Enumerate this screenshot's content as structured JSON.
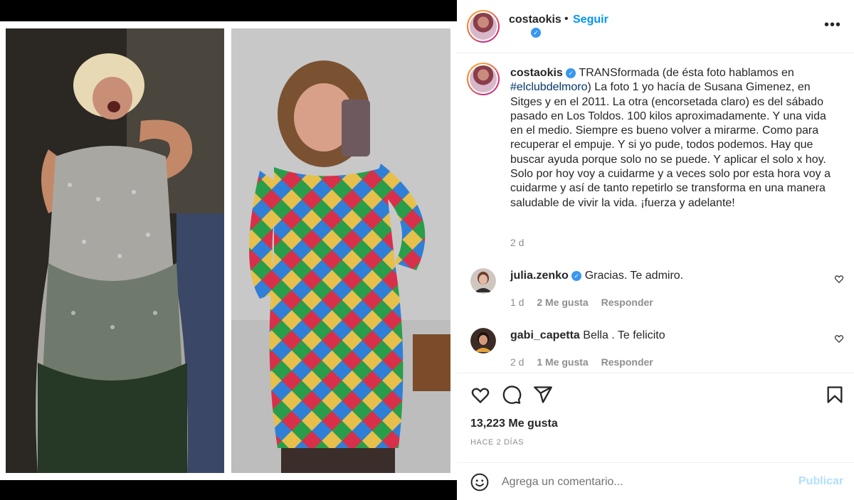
{
  "post": {
    "username": "costaokis",
    "dot": "•",
    "follow_label": "Seguir",
    "more_label": "•••"
  },
  "caption": {
    "username": "costaokis",
    "text_lead": "TRANSformada (de ésta foto hablamos en",
    "hashtag": "#elclubdelmoro",
    "text_after_hashtag": ")",
    "body": "La foto 1 yo hacía de Susana Gimenez, en Sitges y en el 2011. La otra (encorsetada claro) es del sábado pasado en Los Toldos. 100 kilos aproximadamente. Y una vida en el medio. Siempre es bueno volver a mirarme. Como para recuperar el empuje. Y si yo pude, todos podemos. Hay que buscar ayuda porque solo no se puede. Y aplicar el solo x hoy. Solo por hoy voy a cuidarme y a veces solo por esta hora voy a cuidarme y así de tanto repetirlo se transforma en una manera saludable de vivir la vida. ¡fuerza y adelante!",
    "time": "2 d"
  },
  "comments": [
    {
      "username": "julia.zenko",
      "verified": true,
      "text": "Gracias. Te admiro.",
      "time": "1 d",
      "likes": "2 Me gusta",
      "reply": "Responder"
    },
    {
      "username": "gabi_capetta",
      "verified": false,
      "text": "Bella . Te felicito",
      "time": "2 d",
      "likes": "1 Me gusta",
      "reply": "Responder"
    }
  ],
  "stats": {
    "likes": "13,223 Me gusta",
    "posted": "HACE 2 DÍAS"
  },
  "add_comment": {
    "placeholder": "Agrega un comentario...",
    "publish_label": "Publicar"
  },
  "colors": {
    "accent": "#0095f6",
    "publish_disabled": "#b2dffc",
    "verified": "#3897f0",
    "hashtag": "#00376b",
    "muted": "#8e8e8e"
  },
  "icons": [
    "verified-icon",
    "more-options-icon",
    "heart-icon",
    "comment-icon",
    "share-icon",
    "bookmark-icon",
    "emoji-icon"
  ]
}
